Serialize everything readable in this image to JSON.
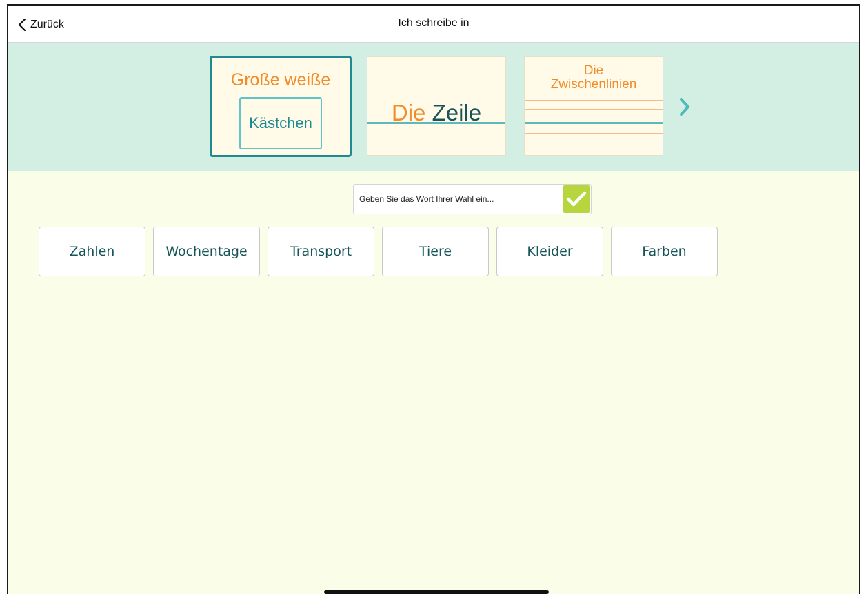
{
  "header": {
    "back_label": "Zurück",
    "title": "Ich schreibe in"
  },
  "paper_types": [
    {
      "line1": "Große weiße",
      "line2": "Kästchen",
      "selected": true
    },
    {
      "word_orange": "Die",
      "word_teal": "Zeile",
      "selected": false
    },
    {
      "line1": "Die",
      "line2": "Zwischenlinien",
      "selected": false
    }
  ],
  "input": {
    "placeholder": "Geben Sie das Wort Ihrer Wahl ein...",
    "value": ""
  },
  "categories": [
    "Zahlen",
    "Wochentage",
    "Transport",
    "Tiere",
    "Kleider",
    "Farben"
  ],
  "colors": {
    "accent_teal": "#1f8a8f",
    "accent_orange": "#f28c2b",
    "band": "#d3efe3",
    "background": "#fafde8",
    "confirm_green": "#b7d63d"
  },
  "icons": [
    "chevron-left-icon",
    "chevron-right-icon",
    "checkmark-icon"
  ]
}
